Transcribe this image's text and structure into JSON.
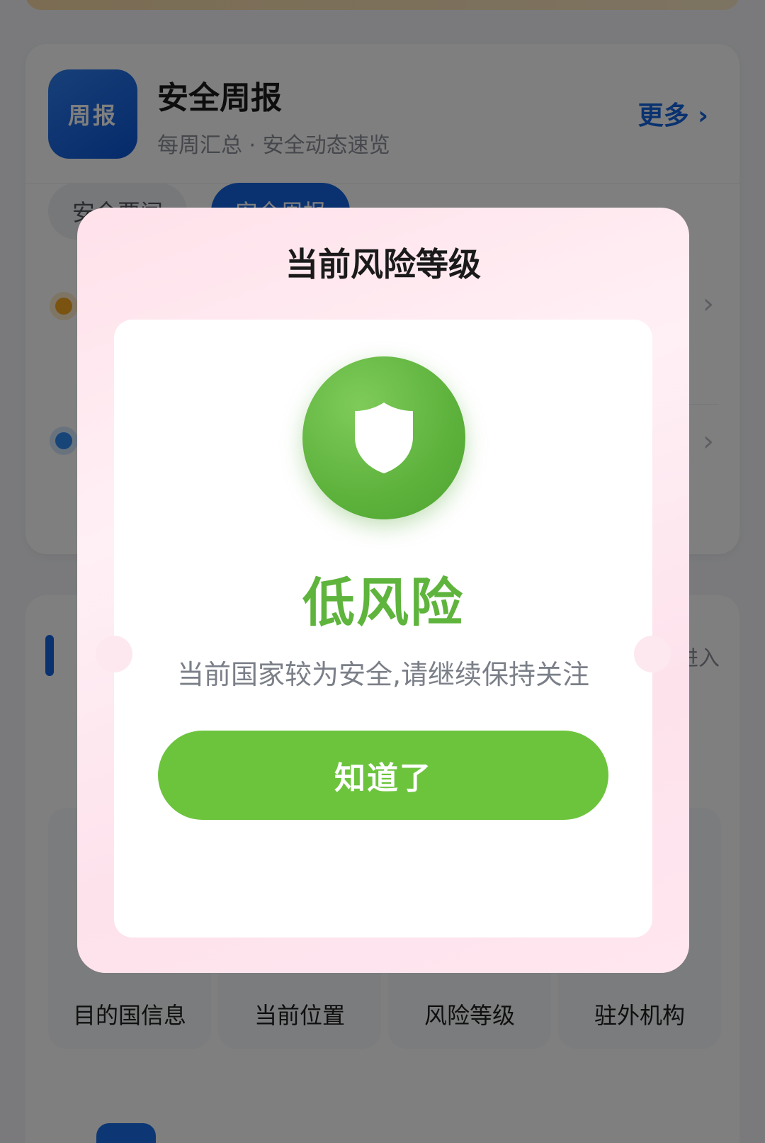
{
  "weekly_card": {
    "logo_text": "周报",
    "title": "安全周报",
    "subtitle": "每周汇总 · 安全动态速览",
    "more_label": "更多",
    "more_chevron": "›",
    "chips": [
      "安全要闻",
      "安全周报"
    ],
    "list_chevron": "›"
  },
  "services_card": {
    "more_label": "进入",
    "items": [
      {
        "label": "目的国信息",
        "icon": "info-icon",
        "color": "#8e6ae8"
      },
      {
        "label": "当前位置",
        "icon": "location-icon",
        "color": "#1fb989"
      },
      {
        "label": "风险等级",
        "icon": "risk-icon",
        "color": "#f08a3c"
      },
      {
        "label": "驻外机构",
        "icon": "embassy-icon",
        "color": "#1fb989"
      }
    ]
  },
  "dialog": {
    "title": "当前风险等级",
    "level": "低风险",
    "description": "当前国家较为安全,请继续保持关注",
    "confirm_label": "知道了",
    "icon": "shield-icon",
    "colors": {
      "accent_green": "#6cc43d",
      "level_text": "#5eb43c",
      "brand_blue": "#1565e0"
    }
  }
}
